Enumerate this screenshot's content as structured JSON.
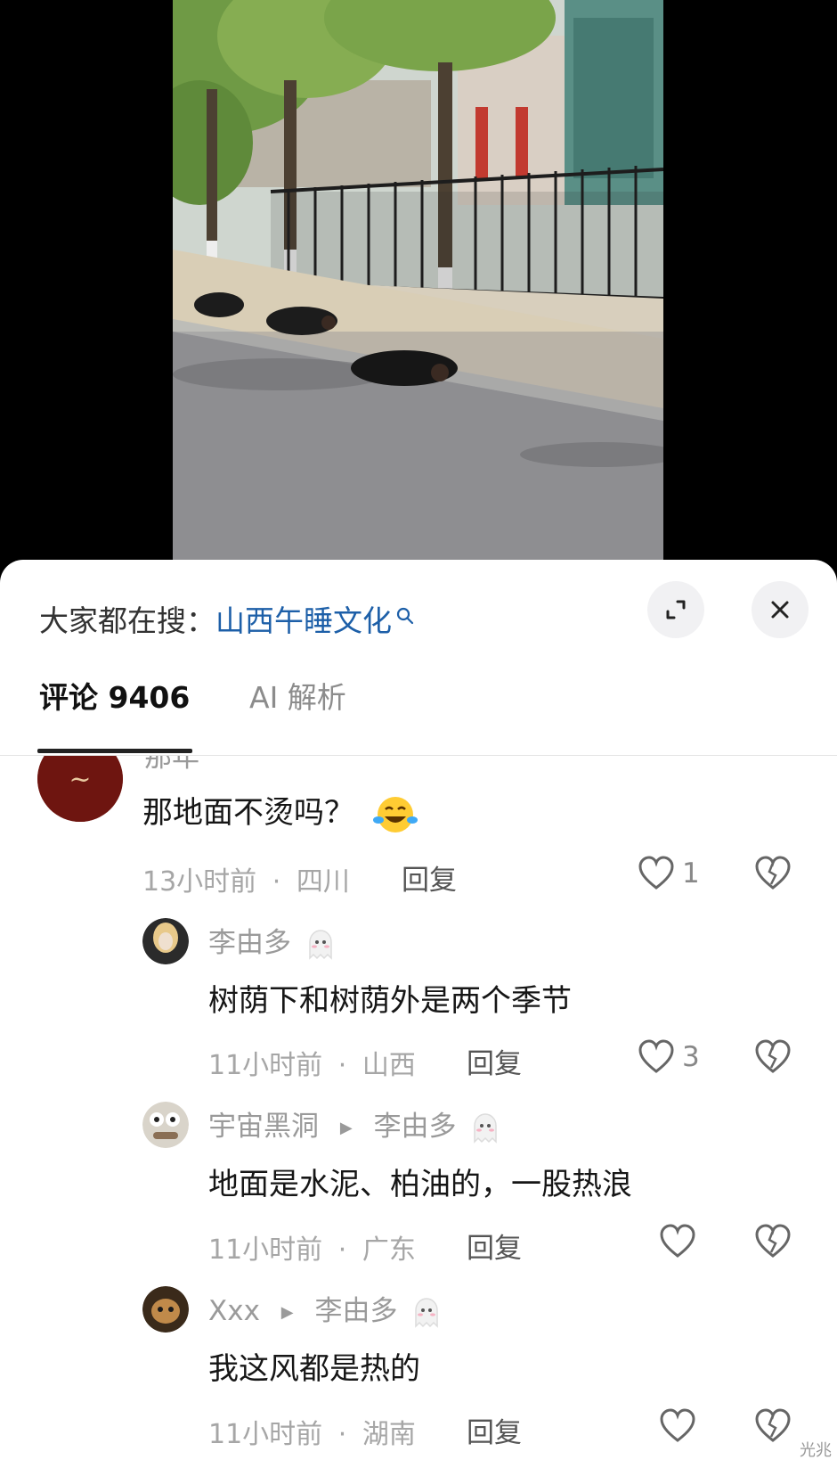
{
  "search": {
    "label": "大家都在搜：",
    "term": "山西午睡文化"
  },
  "tabs": {
    "comments": "评论 9406",
    "ai": "AI 解析"
  },
  "comments": [
    {
      "username": "那年",
      "text": "那地面不烫吗？",
      "emoji": "laughing-crying-emoji",
      "time": "13小时前",
      "location": "四川",
      "reply_label": "回复",
      "likes": "1"
    },
    {
      "username": "李由多",
      "text": "树荫下和树荫外是两个季节",
      "time": "11小时前",
      "location": "山西",
      "reply_label": "回复",
      "likes": "3"
    },
    {
      "username": "宇宙黑洞",
      "reply_to": "李由多",
      "text": "地面是水泥、柏油的，一股热浪",
      "time": "11小时前",
      "location": "广东",
      "reply_label": "回复",
      "likes": ""
    },
    {
      "username": "Xxx",
      "reply_to": "李由多",
      "text": "我这风都是热的",
      "time": "11小时前",
      "location": "湖南",
      "reply_label": "回复",
      "likes": ""
    }
  ],
  "meta_separator": "·",
  "watermark": "光兆",
  "colors": {
    "search_term": "#1d5fa8",
    "tab_active": "#111111",
    "tab_inactive": "#8c8c8c"
  }
}
